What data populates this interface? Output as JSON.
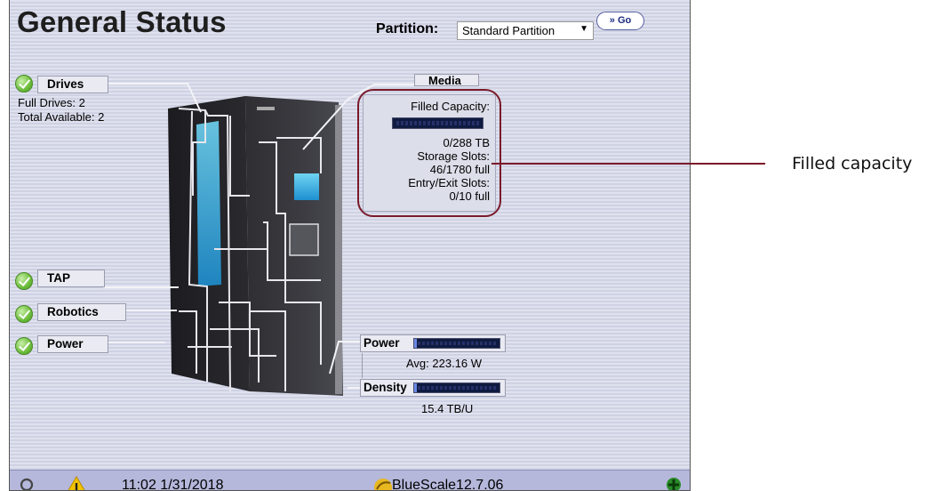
{
  "page": {
    "title": "General Status"
  },
  "partition": {
    "label": "Partition:",
    "selected": "Standard Partition",
    "go_label": "Go"
  },
  "drives": {
    "label": "Drives",
    "full": "Full Drives: 2",
    "total": "Total Available: 2"
  },
  "media": {
    "label": "Media",
    "filled_capacity_label": "Filled Capacity:",
    "filled_capacity_value": "0/288 TB",
    "filled_capacity_fraction": 0,
    "storage_slots_label": "Storage Slots:",
    "storage_slots_value": "46/1780 full",
    "entry_exit_label": "Entry/Exit Slots:",
    "entry_exit_value": "0/10 full"
  },
  "components": {
    "tap": "TAP",
    "robotics": "Robotics",
    "power": "Power"
  },
  "metrics": {
    "power_label": "Power",
    "power_avg": "Avg: 223.16 W",
    "power_fraction": 0.03,
    "density_label": "Density",
    "density_value": "15.4 TB/U",
    "density_fraction": 0.03
  },
  "statusbar": {
    "datetime": "11:02 1/31/2018",
    "version": "BlueScale12.7.06"
  },
  "callout": {
    "text": "Filled capacity"
  },
  "colors": {
    "ok_green": "#6cbd3a",
    "warning_yellow": "#f2c200",
    "callout_red": "#7a1a2a",
    "panel_bg": "#d9dbe9"
  },
  "icons": {
    "status_ok": "check-circle-icon",
    "warning": "warning-triangle-icon",
    "refresh": "refresh-icon",
    "network": "network-icon",
    "bluescale": "bluescale-logo-icon",
    "go": "double-chevron-right-icon"
  }
}
